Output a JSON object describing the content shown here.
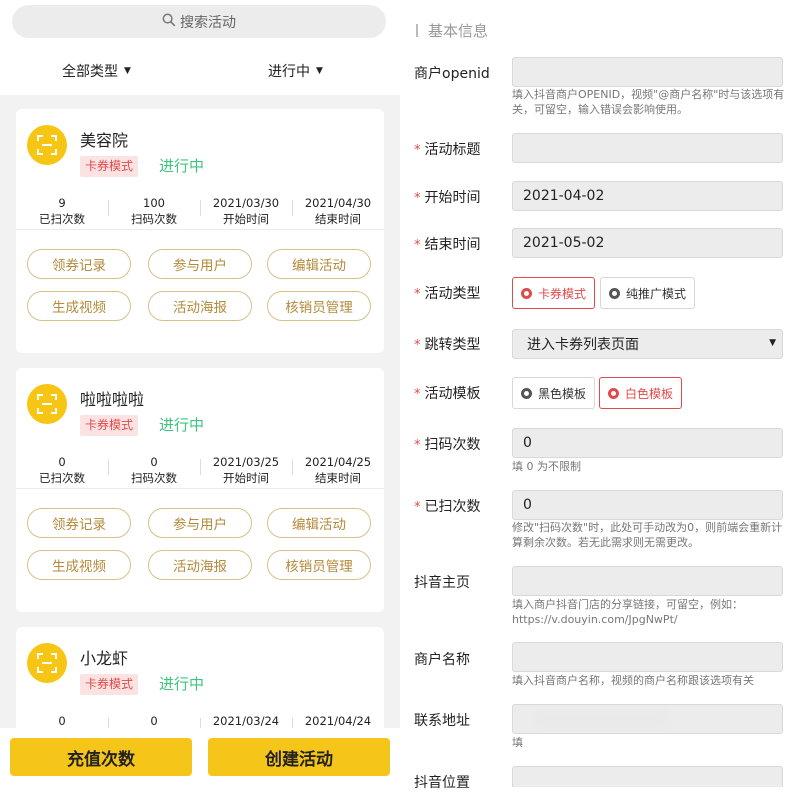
{
  "list": {
    "search_placeholder": "搜索活动",
    "filter_type": "全部类型",
    "filter_status": "进行中",
    "stat_labels": [
      "已扫次数",
      "扫码次数",
      "开始时间",
      "结束时间"
    ],
    "actions": [
      "领券记录",
      "参与用户",
      "编辑活动",
      "生成视频",
      "活动海报",
      "核销员管理"
    ],
    "cards": [
      {
        "name": "美容院",
        "mode": "卡券模式",
        "status": "进行中",
        "scanned": "9",
        "scan_limit": "100",
        "start": "2021/03/30",
        "end": "2021/04/30"
      },
      {
        "name": "啦啦啦啦",
        "mode": "卡券模式",
        "status": "进行中",
        "scanned": "0",
        "scan_limit": "0",
        "start": "2021/03/25",
        "end": "2021/04/25"
      },
      {
        "name": "小龙虾",
        "mode": "卡券模式",
        "status": "进行中",
        "scanned": "0",
        "scan_limit": "0",
        "start": "2021/03/24",
        "end": "2021/04/24"
      }
    ],
    "recharge_button": "充值次数",
    "create_button": "创建活动"
  },
  "form": {
    "section_title": "基本信息",
    "openid_label": "商户openid",
    "openid_hint": "填入抖音商户OPENID，视频\"@商户名称\"时与该选项有关，可留空，输入错误会影响使用。",
    "title_label": "活动标题",
    "start_label": "开始时间",
    "start_value": "2021-04-02",
    "end_label": "结束时间",
    "end_value": "2021-05-02",
    "type_label": "活动类型",
    "type_options": [
      "卡券模式",
      "纯推广模式"
    ],
    "jump_label": "跳转类型",
    "jump_value": "进入卡券列表页面",
    "template_label": "活动模板",
    "template_options": [
      "黑色模板",
      "白色模板"
    ],
    "scan_count_label": "扫码次数",
    "scan_count_value": "0",
    "scan_count_hint": "填 0 为不限制",
    "scanned_label": "已扫次数",
    "scanned_value": "0",
    "scanned_hint": "修改\"扫码次数\"时，此处可手动改为0，则前端会重新计算剩余次数。若无此需求则无需更改。",
    "homepage_label": "抖音主页",
    "homepage_hint": "填入商户抖音门店的分享链接，可留空，例如：https://v.douyin.com/JpgNwPt/",
    "merchant_name_label": "商户名称",
    "merchant_name_hint": "填入抖音商户名称，视频的商户名称跟该选项有关",
    "address_label": "联系地址",
    "address_hint": "填",
    "location_label": "抖音位置",
    "required_mark": "*"
  },
  "colors": {
    "accent_yellow": "#f6c51a",
    "status_green": "#3dc47e",
    "badge_red": "#e04a4a",
    "pill_gold": "#b48a3c"
  }
}
